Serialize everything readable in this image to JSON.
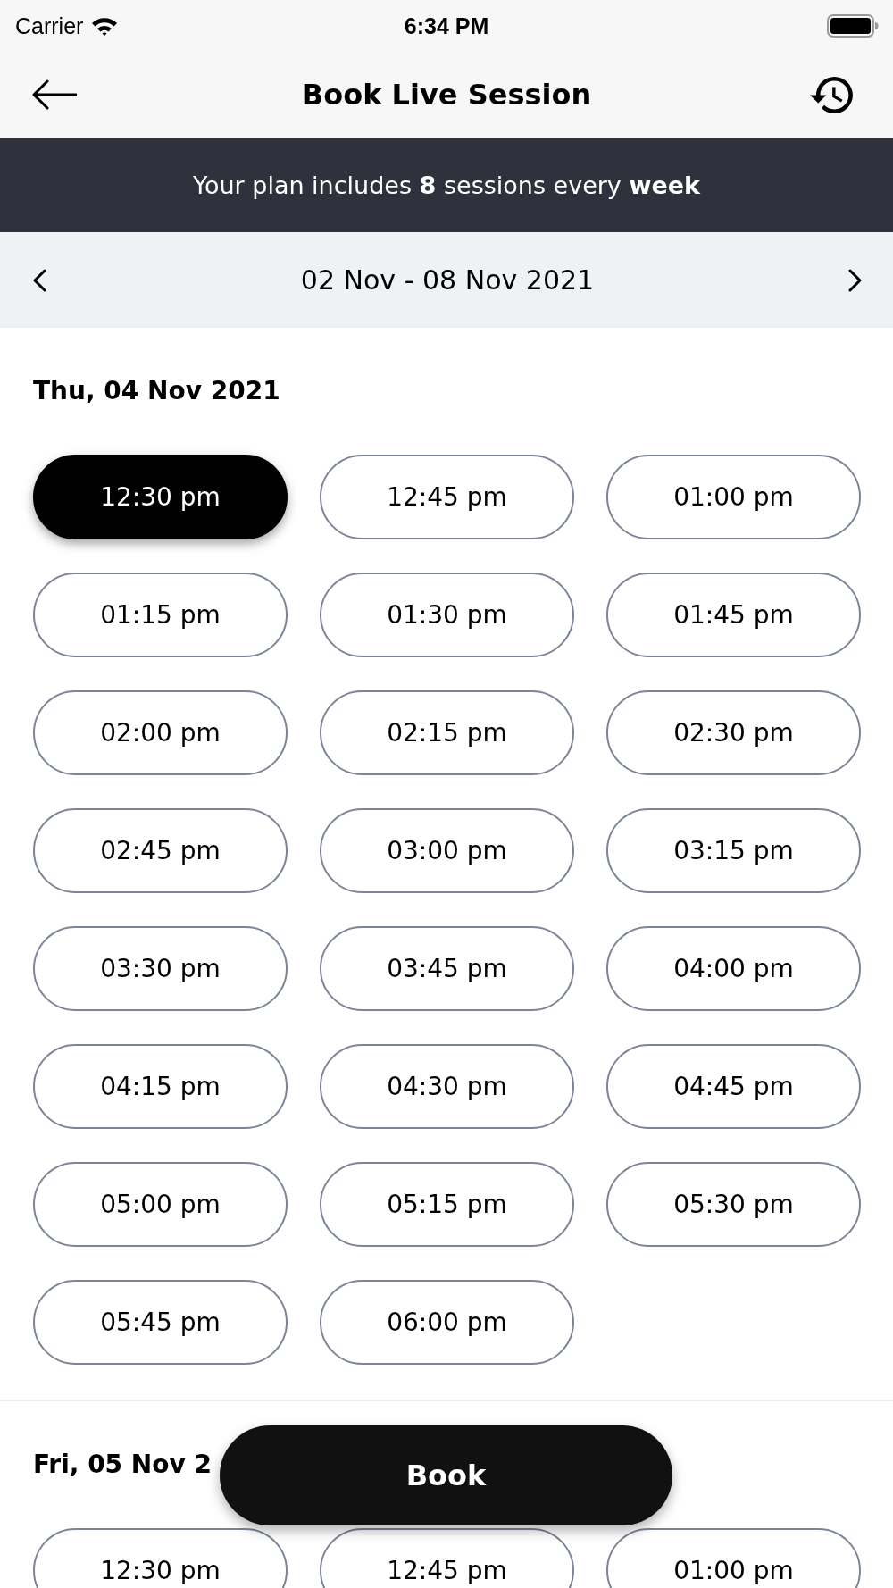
{
  "status_bar": {
    "carrier": "Carrier",
    "time": "6:34 PM"
  },
  "header": {
    "title": "Book Live Session"
  },
  "banner": {
    "text": "Your plan includes **8** sessions every **week**"
  },
  "week_nav": {
    "range": "02 Nov - 08 Nov 2021"
  },
  "days": [
    {
      "date": "Thu, 04 Nov 2021",
      "slots": [
        {
          "time": "12:30 pm",
          "selected": true
        },
        {
          "time": "12:45 pm",
          "selected": false
        },
        {
          "time": "01:00 pm",
          "selected": false
        },
        {
          "time": "01:15 pm",
          "selected": false
        },
        {
          "time": "01:30 pm",
          "selected": false
        },
        {
          "time": "01:45 pm",
          "selected": false
        },
        {
          "time": "02:00 pm",
          "selected": false
        },
        {
          "time": "02:15 pm",
          "selected": false
        },
        {
          "time": "02:30 pm",
          "selected": false
        },
        {
          "time": "02:45 pm",
          "selected": false
        },
        {
          "time": "03:00 pm",
          "selected": false
        },
        {
          "time": "03:15 pm",
          "selected": false
        },
        {
          "time": "03:30 pm",
          "selected": false
        },
        {
          "time": "03:45 pm",
          "selected": false
        },
        {
          "time": "04:00 pm",
          "selected": false
        },
        {
          "time": "04:15 pm",
          "selected": false
        },
        {
          "time": "04:30 pm",
          "selected": false
        },
        {
          "time": "04:45 pm",
          "selected": false
        },
        {
          "time": "05:00 pm",
          "selected": false
        },
        {
          "time": "05:15 pm",
          "selected": false
        },
        {
          "time": "05:30 pm",
          "selected": false
        },
        {
          "time": "05:45 pm",
          "selected": false
        },
        {
          "time": "06:00 pm",
          "selected": false
        }
      ]
    },
    {
      "date": "Fri, 05 Nov 2",
      "slots": [
        {
          "time": "12:30 pm",
          "selected": false
        },
        {
          "time": "12:45 pm",
          "selected": false
        },
        {
          "time": "01:00 pm",
          "selected": false
        }
      ]
    }
  ],
  "book_button": {
    "label": "Book"
  }
}
